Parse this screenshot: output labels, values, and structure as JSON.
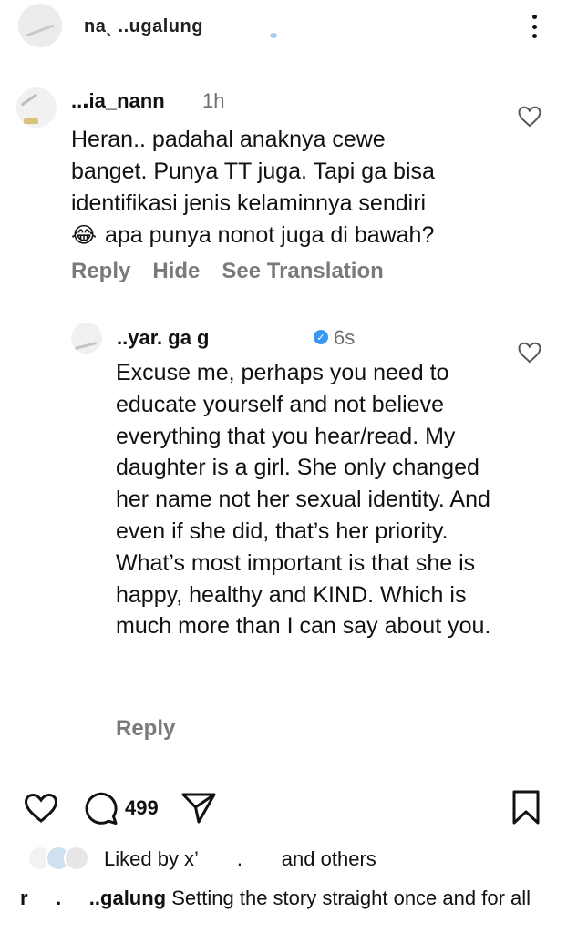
{
  "header": {
    "username": "naˎ      ..ugalung",
    "menu_icon": "more-vertical-icon"
  },
  "comment": {
    "username": "..․ia_nann",
    "time": "1h",
    "text_lines": [
      "Heran.. padahal anaknya cewe",
      "banget. Punya TT juga. Tapi ga bisa",
      "identifikasi jenis kelaminnya sendiri"
    ],
    "emoji": "😂",
    "last_line": " apa punya nonot juga di bawah?",
    "actions": [
      "Reply",
      "Hide",
      "See Translation"
    ],
    "like_icon": "heart-outline-icon"
  },
  "reply": {
    "username": "..yar.     ga  g",
    "verified_icon": "verified-badge-icon",
    "time": "6s",
    "text": "Excuse me, perhaps you need to educate yourself and not believe everything that you hear/read. My daughter is a girl. She only changed her name not her sexual identity. And even if she did, that’s her priority. What’s most important is that she is happy, healthy and KIND. Which is much more than I can say about you.",
    "action": "Reply",
    "like_icon": "heart-outline-icon"
  },
  "action_bar": {
    "like_icon": "heart-outline-icon",
    "comment_icon": "comment-bubble-icon",
    "comment_count": "499",
    "share_icon": "paper-plane-icon",
    "save_icon": "bookmark-icon"
  },
  "likes": {
    "text": "Liked by x’       .       and others"
  },
  "caption": {
    "username": "r     .     ..galung",
    "text": " Setting the story straight once and for all"
  }
}
